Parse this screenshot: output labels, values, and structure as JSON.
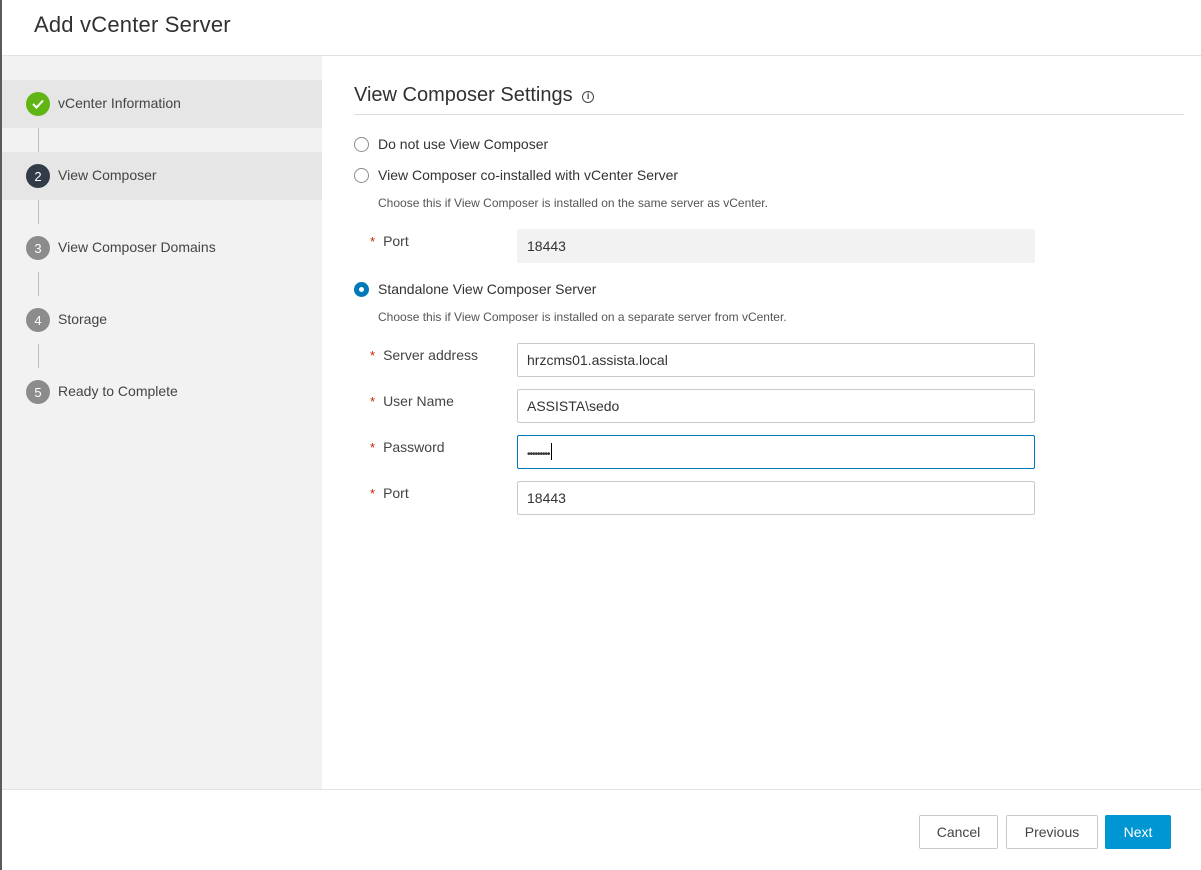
{
  "dialog": {
    "title": "Add vCenter Server"
  },
  "wizard": {
    "steps": [
      {
        "number": "",
        "label": "vCenter Information",
        "state": "done",
        "icon": "check-icon"
      },
      {
        "number": "2",
        "label": "View Composer",
        "state": "active"
      },
      {
        "number": "3",
        "label": "View Composer Domains",
        "state": "todo"
      },
      {
        "number": "4",
        "label": "Storage",
        "state": "todo"
      },
      {
        "number": "5",
        "label": "Ready to Complete",
        "state": "todo"
      }
    ]
  },
  "main": {
    "section_title": "View Composer Settings",
    "info_icon": "info-icon",
    "options": [
      {
        "label": "Do not use View Composer",
        "selected": false
      },
      {
        "label": "View Composer co-installed with vCenter Server",
        "selected": false,
        "helper": "Choose this if View Composer is installed on the same server as vCenter."
      },
      {
        "label": "Standalone View Composer Server",
        "selected": true,
        "helper": "Choose this if View Composer is installed on a separate server from vCenter."
      }
    ],
    "coinstalled": {
      "port_label": "Port",
      "port_value": "18443"
    },
    "standalone": {
      "server_address_label": "Server address",
      "server_address_value": "hrzcms01.assista.local",
      "username_label": "User Name",
      "username_value": "ASSISTA\\sedo",
      "password_label": "Password",
      "password_value": "•••••••••",
      "port_label": "Port",
      "port_value": "18443"
    },
    "required_marker": "*"
  },
  "footer": {
    "cancel_label": "Cancel",
    "previous_label": "Previous",
    "next_label": "Next"
  },
  "colors": {
    "accent": "#0079b8",
    "primary_button": "#0095d3",
    "success": "#60b515",
    "required": "#c92100"
  }
}
